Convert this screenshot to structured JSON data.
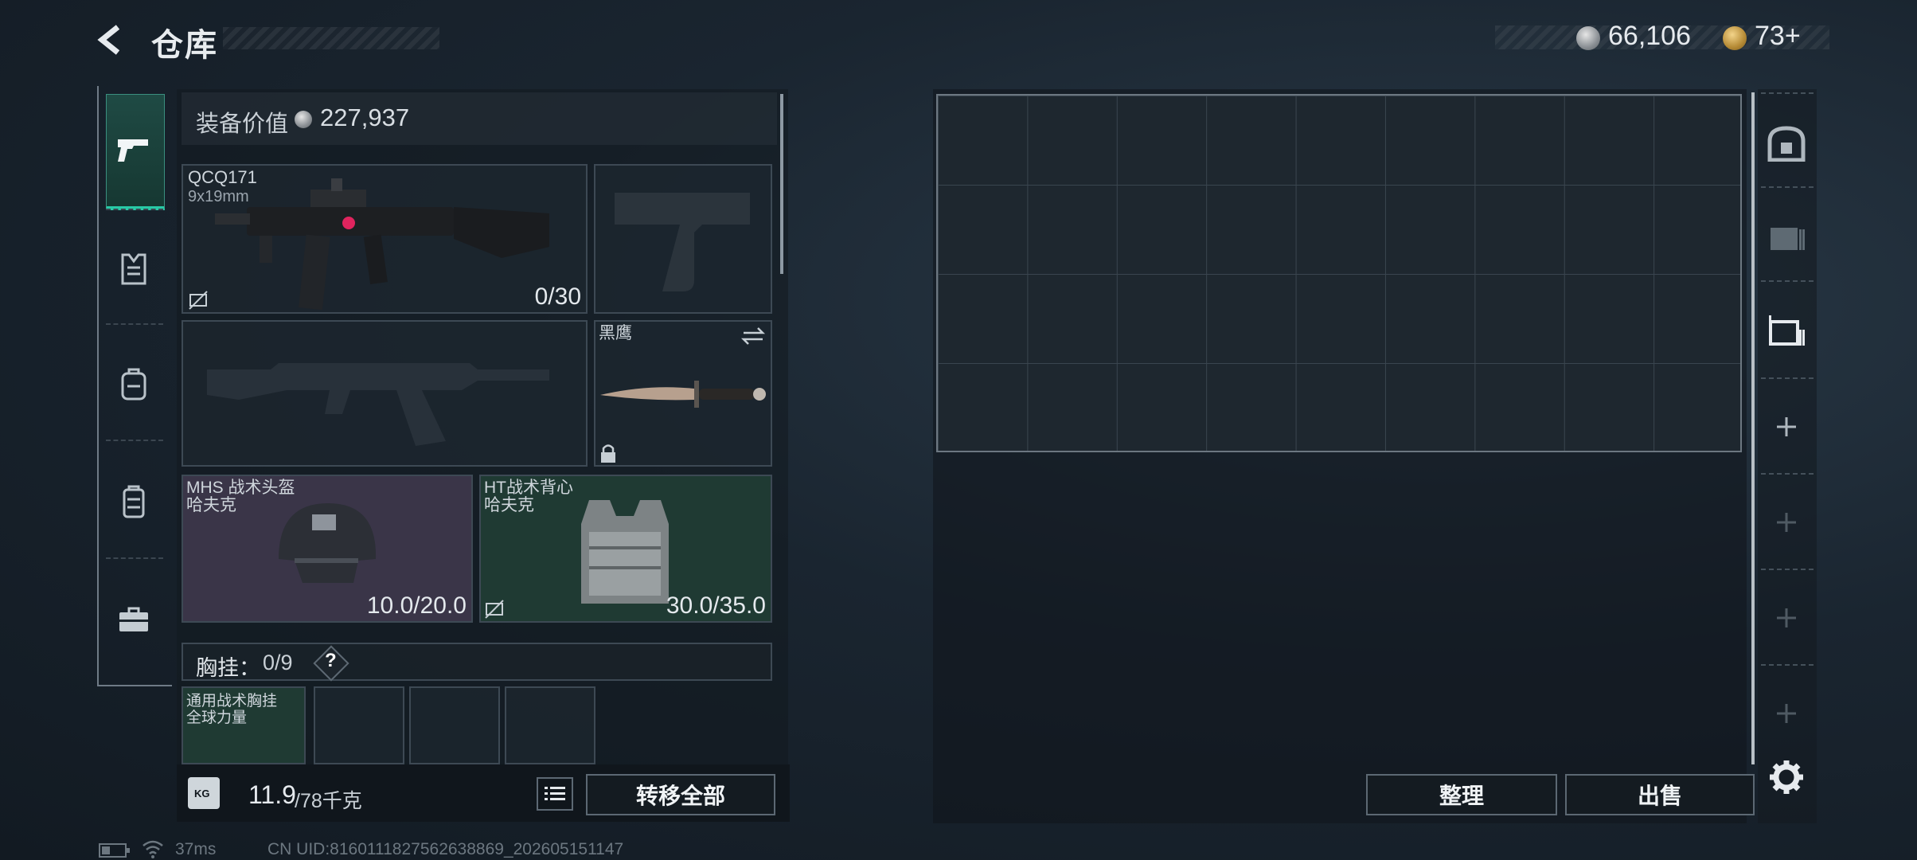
{
  "header": {
    "title": "仓库",
    "currency": [
      {
        "icon": "silver-coin-icon",
        "value": "66,106"
      },
      {
        "icon": "gold-coin-icon",
        "value": "73+"
      }
    ]
  },
  "nav": {
    "items": [
      {
        "name": "weapons-tab",
        "icon": "pistol-icon",
        "active": true
      },
      {
        "name": "armor-tab",
        "icon": "vest-icon"
      },
      {
        "name": "backpack-tab",
        "icon": "backpack-icon"
      },
      {
        "name": "chest-rig-tab",
        "icon": "chest-rig-icon"
      },
      {
        "name": "case-tab",
        "icon": "briefcase-icon"
      }
    ]
  },
  "equipment": {
    "value_label": "装备价值",
    "value": "227,937",
    "primary_weapon": {
      "name": "QCQ171",
      "ammo": "9x19mm",
      "count": "0/30"
    },
    "melee": {
      "name": "黑鹰"
    },
    "helmet": {
      "name": "MHS 战术头盔",
      "brand": "哈夫克",
      "durability": "10.0/20.0"
    },
    "armor": {
      "name": "HT战术背心",
      "brand": "哈夫克",
      "durability": "30.0/35.0"
    },
    "chest_rig": {
      "label": "胸挂：",
      "count": "0/9",
      "help": "?"
    },
    "rig_item": {
      "name": "通用战术胸挂",
      "brand": "全球力量"
    }
  },
  "bottom": {
    "weight": "11.9",
    "weight_max": "/78千克",
    "kg_icon_label": "KG",
    "transfer_all": "转移全部"
  },
  "stash": {
    "sort_label": "整理",
    "sell_label": "出售"
  },
  "status": {
    "ping": "37ms",
    "uid": "CN UID:8160111827562638869_202605151147"
  },
  "colors": {
    "accent_teal": "#28c9a6",
    "helmet_slot_bg": "#3a3548",
    "armor_slot_bg": "#1f3a33"
  }
}
